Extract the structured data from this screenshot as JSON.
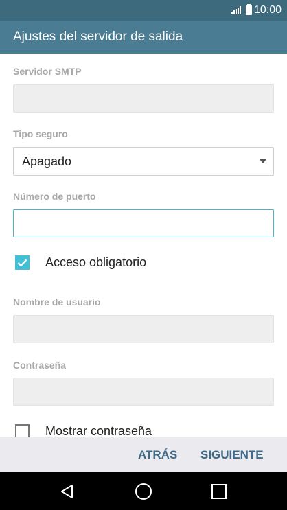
{
  "status_bar": {
    "time": "10:00"
  },
  "app_bar": {
    "title": "Ajustes del servidor de salida"
  },
  "form": {
    "smtp_server": {
      "label": "Servidor SMTP",
      "value": ""
    },
    "security_type": {
      "label": "Tipo seguro",
      "value": "Apagado"
    },
    "port_number": {
      "label": "Número de puerto",
      "value": ""
    },
    "auth_required": {
      "label": "Acceso obligatorio",
      "checked": true
    },
    "username": {
      "label": "Nombre de usuario",
      "value": ""
    },
    "password": {
      "label": "Contraseña",
      "value": ""
    },
    "show_password": {
      "label": "Mostrar contraseña",
      "checked": false
    }
  },
  "bottom_bar": {
    "back_label": "ATRÁS",
    "next_label": "SIGUIENTE"
  },
  "colors": {
    "status_bar": "#3e6a7e",
    "app_bar": "#4a7d93",
    "accent": "#41c0d6",
    "button_text": "#3e6a88"
  },
  "nav_bar": {
    "icons": [
      "back-icon",
      "home-icon",
      "recents-icon"
    ]
  }
}
